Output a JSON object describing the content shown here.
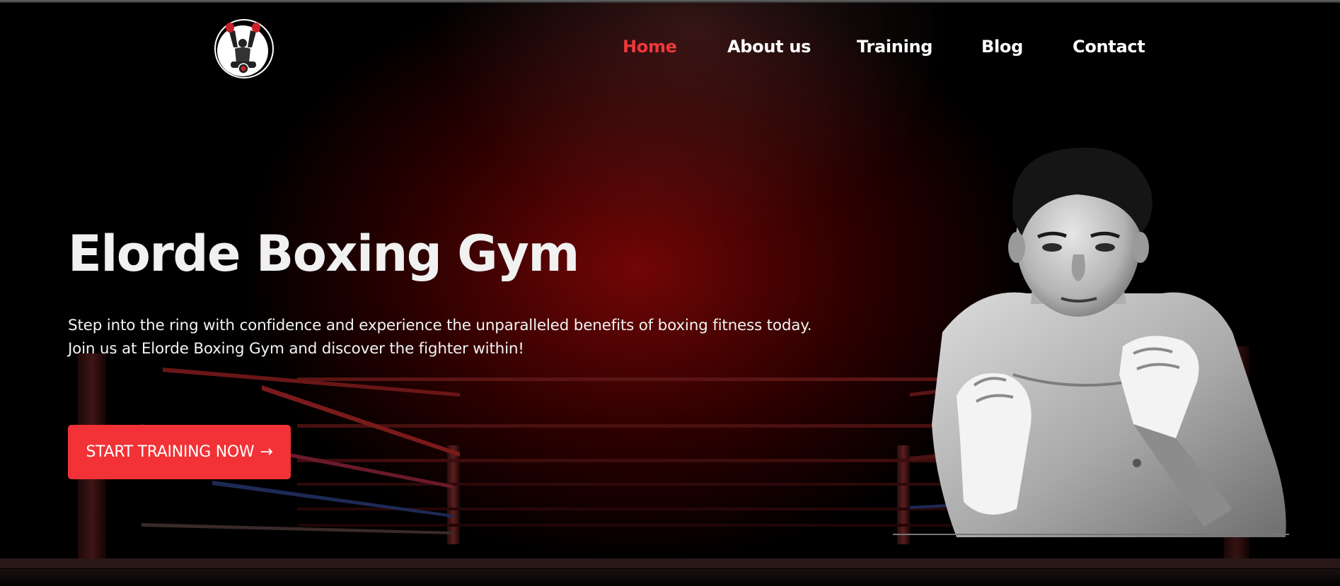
{
  "header": {
    "logo_icon": "boxer-champion-belt-logo",
    "nav": [
      {
        "label": "Home",
        "active": true
      },
      {
        "label": "About us",
        "active": false
      },
      {
        "label": "Training",
        "active": false
      },
      {
        "label": "Blog",
        "active": false
      },
      {
        "label": "Contact",
        "active": false
      }
    ]
  },
  "hero": {
    "title": "Elorde Boxing Gym",
    "subtitle_line1": "Step into the ring with confidence and experience the unparalleled benefits of boxing fitness today.",
    "subtitle_line2": "Join us at Elorde Boxing Gym and discover the fighter within!",
    "cta_label": "START TRAINING NOW",
    "cta_icon": "arrow-right-icon"
  },
  "colors": {
    "accent": "#f23236",
    "nav_active": "#f0383c",
    "background": "#000000",
    "glow": "#780606"
  }
}
